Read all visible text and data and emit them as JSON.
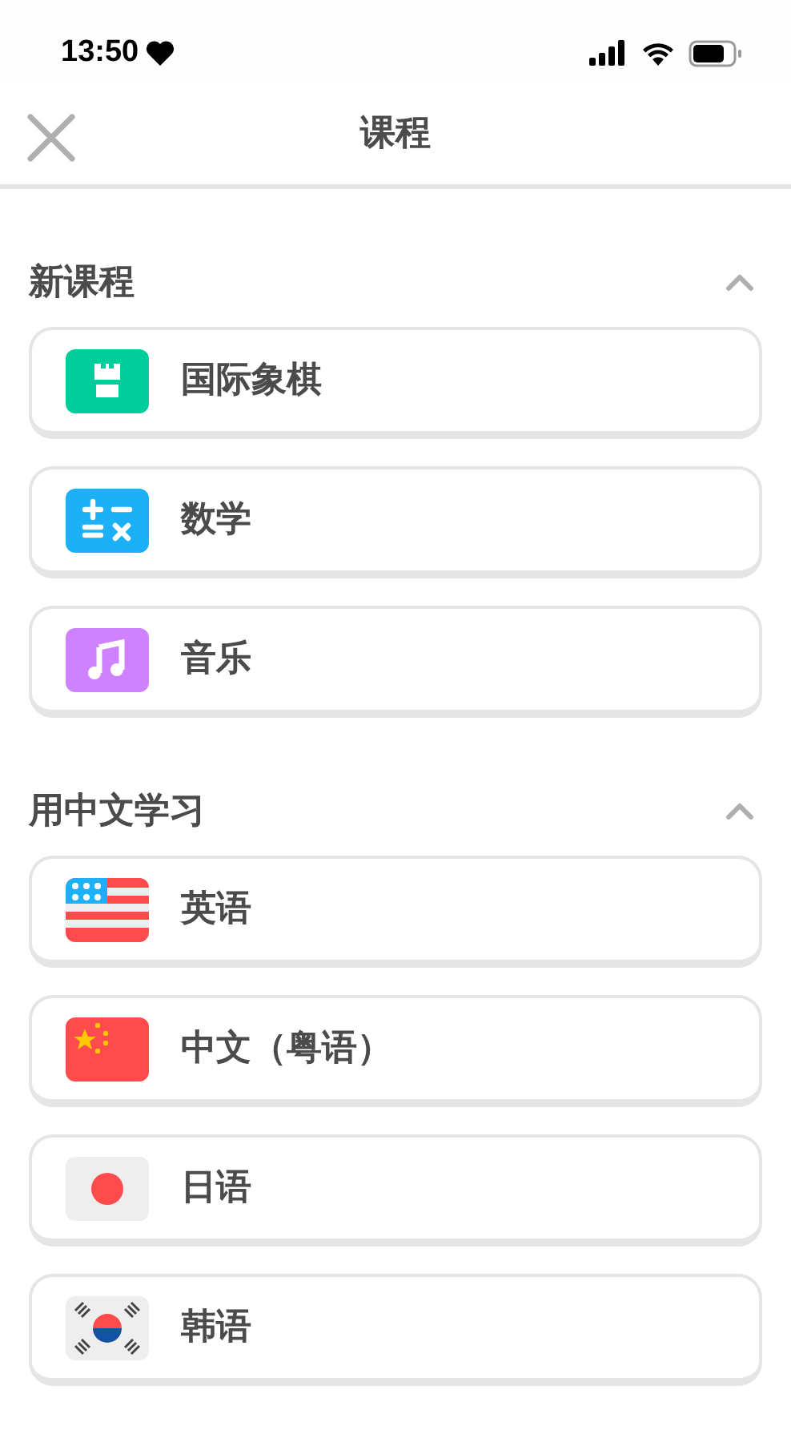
{
  "status_bar": {
    "time": "13:50"
  },
  "header": {
    "title": "课程"
  },
  "sections": [
    {
      "title": "新课程",
      "expanded": true,
      "items": [
        {
          "label": "国际象棋",
          "kind": "chess"
        },
        {
          "label": "数学",
          "kind": "math"
        },
        {
          "label": "音乐",
          "kind": "music"
        }
      ]
    },
    {
      "title": "用中文学习",
      "expanded": true,
      "items": [
        {
          "label": "英语",
          "kind": "flag-us"
        },
        {
          "label": "中文（粤语）",
          "kind": "flag-cn"
        },
        {
          "label": "日语",
          "kind": "flag-jp"
        },
        {
          "label": "韩语",
          "kind": "flag-kr"
        }
      ]
    }
  ]
}
